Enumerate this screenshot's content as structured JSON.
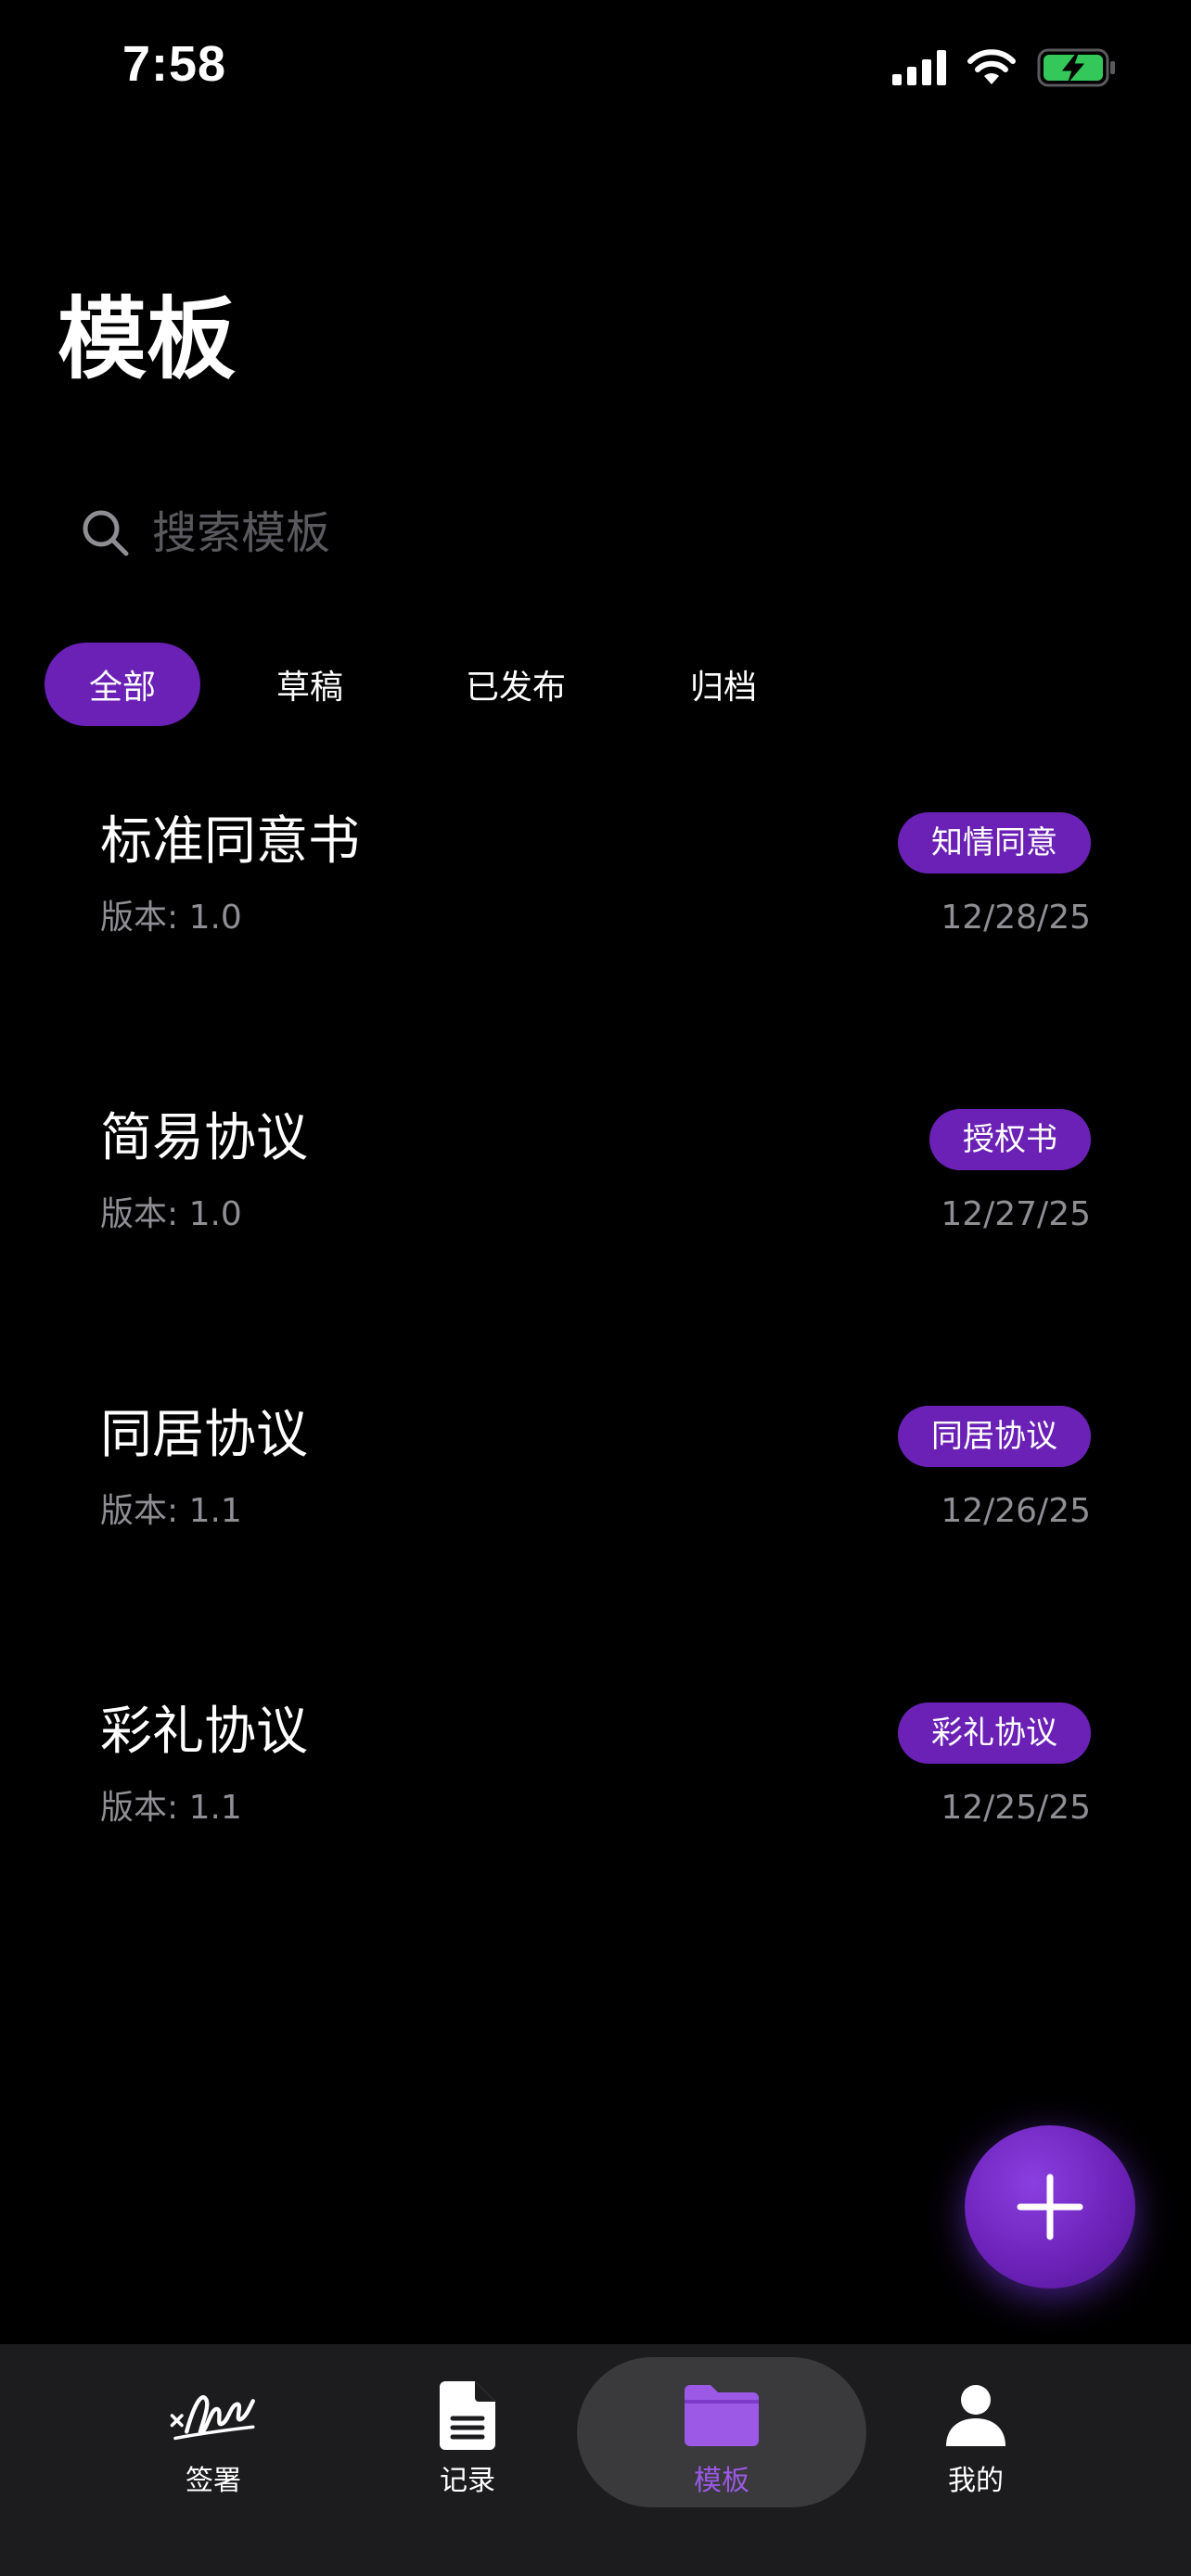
{
  "status_bar": {
    "time": "7:58"
  },
  "header": {
    "title": "模板"
  },
  "search": {
    "placeholder": "搜索模板",
    "value": ""
  },
  "filters": {
    "all": "全部",
    "drafts": "草稿",
    "published": "已发布",
    "archived": "归档",
    "active": "all"
  },
  "templates": [
    {
      "name": "标准同意书",
      "version": "版本: 1.0",
      "tag": "知情同意",
      "date": "12/28/25"
    },
    {
      "name": "简易协议",
      "version": "版本: 1.0",
      "tag": "授权书",
      "date": "12/27/25"
    },
    {
      "name": "同居协议",
      "version": "版本: 1.1",
      "tag": "同居协议",
      "date": "12/26/25"
    },
    {
      "name": "彩礼协议",
      "version": "版本: 1.1",
      "tag": "彩礼协议",
      "date": "12/25/25"
    }
  ],
  "tabbar": {
    "sign": "签署",
    "records": "记录",
    "templates": "模板",
    "me": "我的",
    "active": "templates"
  },
  "colors": {
    "accent": "#6b21b6",
    "accent_text": "#9b59e6",
    "secondary_text": "#8e8e93",
    "battery": "#34c759"
  },
  "icons": {
    "search": "search-icon",
    "add": "plus-icon",
    "sign": "signature-icon",
    "records": "document-icon",
    "templates": "folder-icon",
    "me": "person-icon"
  }
}
